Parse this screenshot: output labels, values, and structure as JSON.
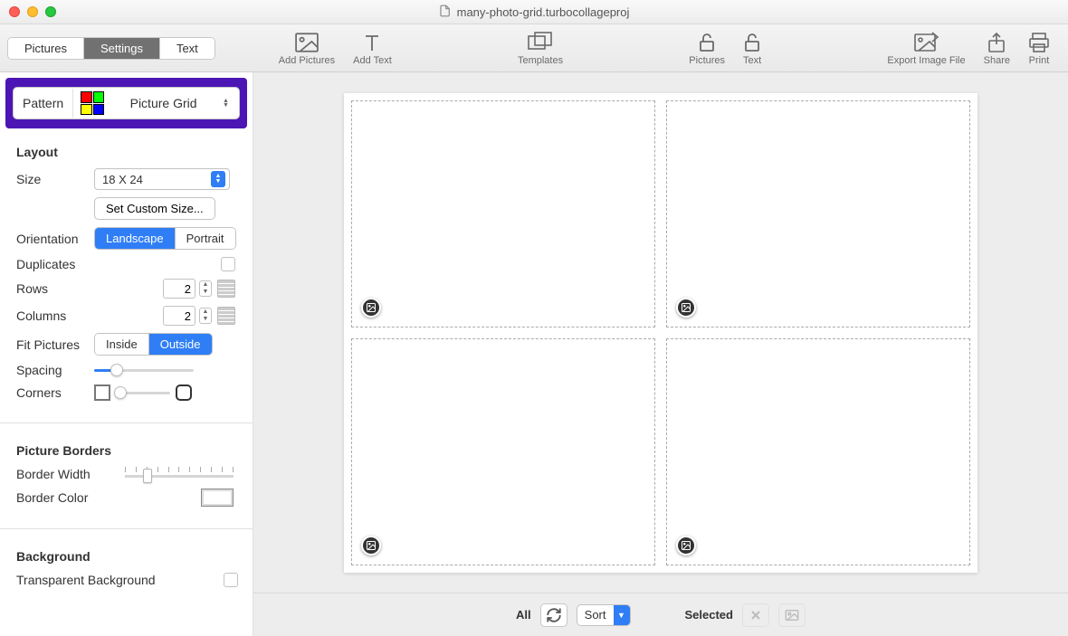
{
  "window": {
    "title": "many-photo-grid.turbocollageproj"
  },
  "tabs": {
    "pictures": "Pictures",
    "settings": "Settings",
    "text": "Text",
    "active": "settings"
  },
  "toolbar": {
    "add_pictures": "Add Pictures",
    "add_text": "Add Text",
    "templates": "Templates",
    "lock_pictures": "Pictures",
    "lock_text": "Text",
    "export": "Export Image File",
    "share": "Share",
    "print": "Print"
  },
  "pattern": {
    "label": "Pattern",
    "value": "Picture Grid"
  },
  "layout": {
    "heading": "Layout",
    "size_label": "Size",
    "size_value": "18 X 24",
    "custom_size": "Set Custom Size...",
    "orientation_label": "Orientation",
    "orientation_landscape": "Landscape",
    "orientation_portrait": "Portrait",
    "duplicates_label": "Duplicates",
    "rows_label": "Rows",
    "rows_value": "2",
    "columns_label": "Columns",
    "columns_value": "2",
    "fit_label": "Fit Pictures",
    "fit_inside": "Inside",
    "fit_outside": "Outside",
    "spacing_label": "Spacing",
    "corners_label": "Corners"
  },
  "borders": {
    "heading": "Picture Borders",
    "width_label": "Border Width",
    "color_label": "Border Color"
  },
  "background": {
    "heading": "Background",
    "transparent_label": "Transparent Background"
  },
  "bottombar": {
    "all": "All",
    "sort": "Sort",
    "selected": "Selected"
  }
}
